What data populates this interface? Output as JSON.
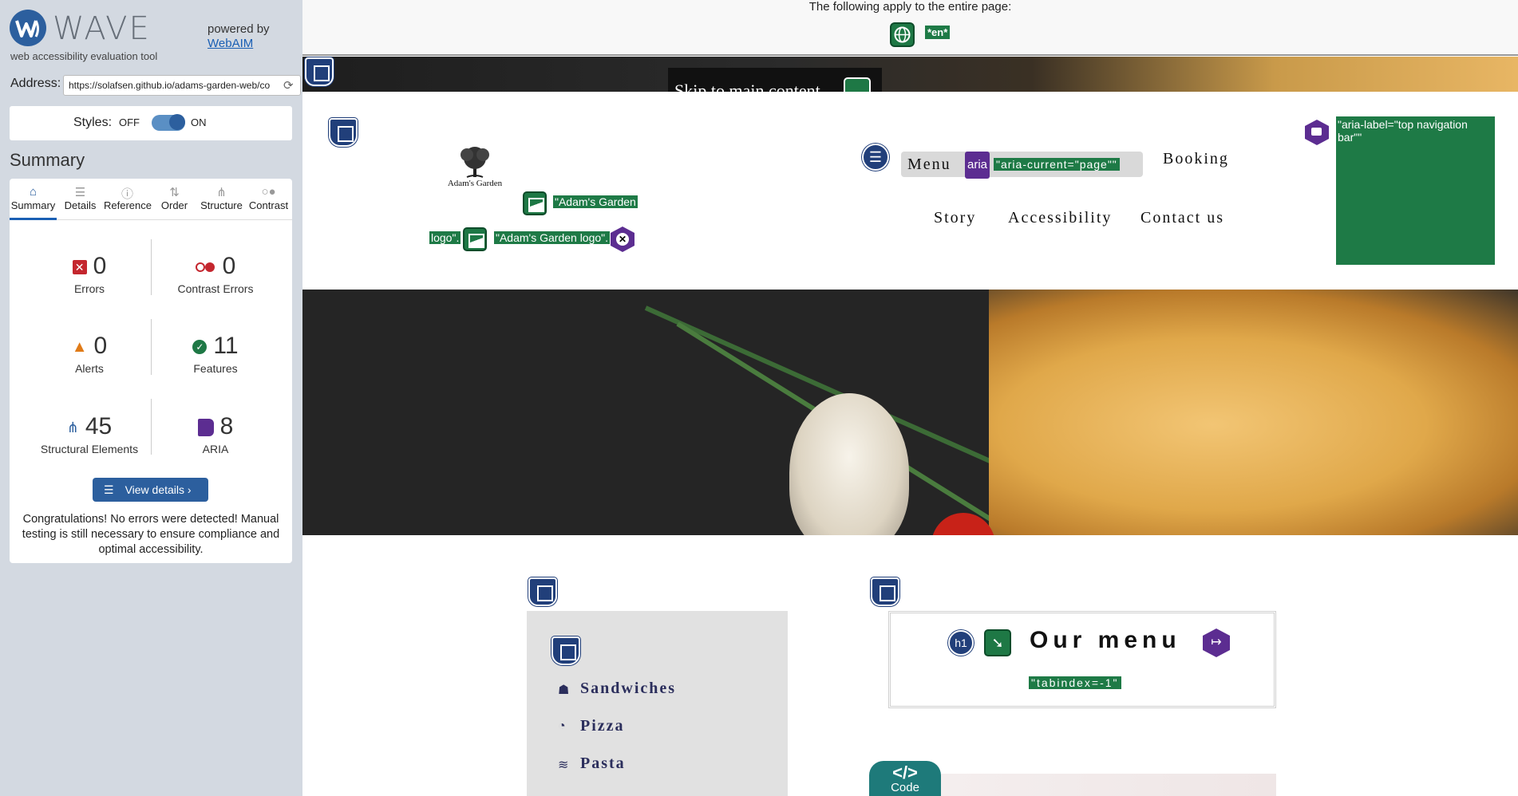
{
  "wave": {
    "title": "WAVE",
    "subtitle": "web accessibility evaluation tool",
    "powered_by": "powered by",
    "webaim_link": "WebAIM",
    "address_label": "Address:",
    "address_value": "https://solafsen.github.io/adams-garden-web/co",
    "styles_label": "Styles:",
    "styles_off": "OFF",
    "styles_on": "ON",
    "summary_title": "Summary",
    "tabs": [
      {
        "label": "Summary",
        "icon": "home-icon"
      },
      {
        "label": "Details",
        "icon": "list-icon"
      },
      {
        "label": "Reference",
        "icon": "info-icon"
      },
      {
        "label": "Order",
        "icon": "order-icon"
      },
      {
        "label": "Structure",
        "icon": "structure-icon"
      },
      {
        "label": "Contrast",
        "icon": "contrast-icon"
      }
    ],
    "stats": {
      "errors": {
        "value": "0",
        "label": "Errors"
      },
      "contrast_errors": {
        "value": "0",
        "label": "Contrast Errors"
      },
      "alerts": {
        "value": "0",
        "label": "Alerts"
      },
      "features": {
        "value": "11",
        "label": "Features"
      },
      "structural": {
        "value": "45",
        "label": "Structural Elements"
      },
      "aria": {
        "value": "8",
        "label": "ARIA"
      }
    },
    "view_details": "View details ›",
    "congrats": "Congratulations! No errors were detected! Manual testing is still necessary to ensure compliance and optimal accessibility."
  },
  "page": {
    "banner_text": "The following apply to the entire page:",
    "lang_tag": "*en*",
    "skip_link": "Skip to main content",
    "logo_caption": "Adam's Garden",
    "alt_text_1a": "\"Adam's Garden",
    "alt_text_1b": "logo\".",
    "alt_text_2": "\"Adam's Garden logo\".",
    "nav": {
      "menu": "Menu",
      "booking": "Booking",
      "story": "Story",
      "accessibility": "Accessibility",
      "contact": "Contact us"
    },
    "aria_badge": "aria",
    "aria_current": "\"aria-current=\"page\"\"",
    "aria_label": "\"aria-label=\"top navigation bar\"\"",
    "side_menu": [
      {
        "label": "Sandwiches",
        "icon": "sandwich-icon"
      },
      {
        "label": "Pizza",
        "icon": "pizza-icon"
      },
      {
        "label": "Pasta",
        "icon": "pasta-icon"
      }
    ],
    "h1_badge": "h1",
    "our_menu": "Our menu",
    "tabindex": "\"tabindex=-1\"",
    "code_label": "Code",
    "code_symbol": "</>"
  },
  "colors": {
    "wave_blue": "#2c5f9e",
    "feature_green": "#1e7845",
    "aria_purple": "#5c2d91",
    "structure_navy": "#213f7a",
    "error_red": "#c4262e",
    "alert_orange": "#e07b18"
  }
}
